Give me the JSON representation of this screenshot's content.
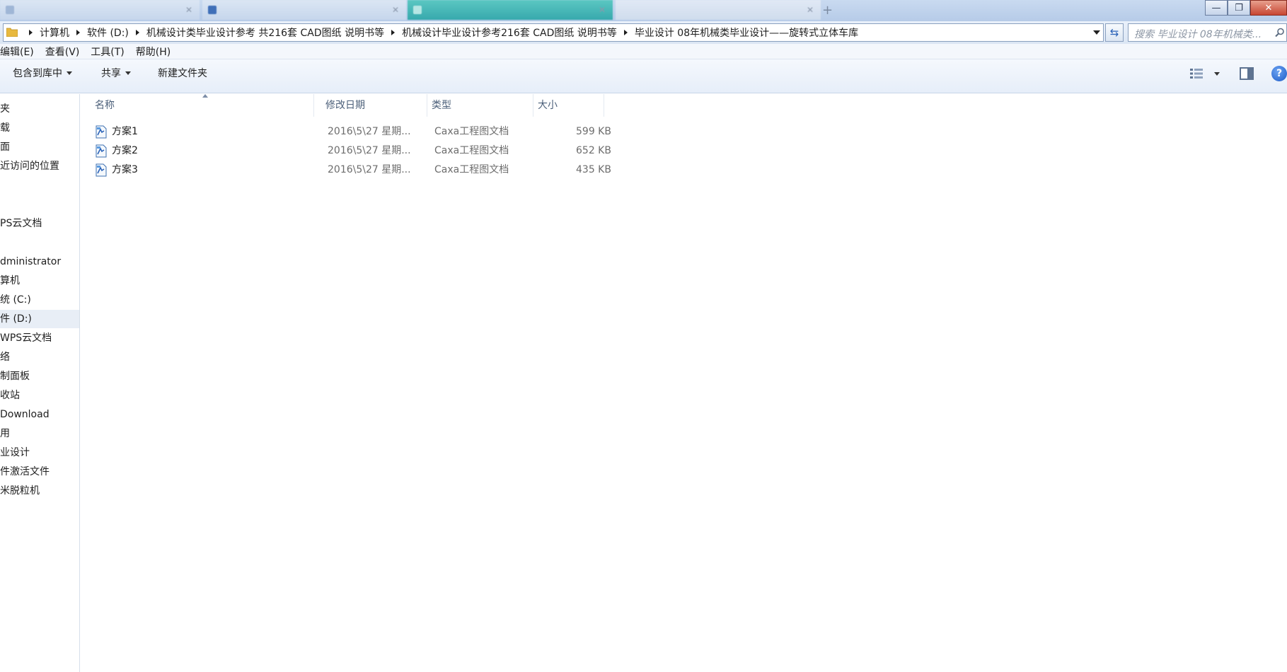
{
  "tabs": [
    {
      "label": "blurred tab"
    },
    {
      "label": "blurred tab"
    },
    {
      "label": "blurred tab"
    },
    {
      "label": "blurred tab"
    }
  ],
  "window_controls": {
    "minimize": "—",
    "maximize": "❐",
    "close": "✕"
  },
  "address": {
    "crumbs": [
      "计算机",
      "软件 (D:)",
      "机械设计类毕业设计参考 共216套 CAD图纸 说明书等",
      "机械设计毕业设计参考216套 CAD图纸 说明书等",
      "毕业设计 08年机械类毕业设计——旋转式立体车库"
    ]
  },
  "search": {
    "placeholder": "搜索 毕业设计 08年机械类..."
  },
  "menu": [
    "编辑(E)",
    "查看(V)",
    "工具(T)",
    "帮助(H)"
  ],
  "toolbar": {
    "include_library": "包含到库中",
    "share": "共享",
    "new_folder": "新建文件夹",
    "help": "?"
  },
  "sidebar": {
    "items": [
      {
        "label": "夹"
      },
      {
        "label": "载"
      },
      {
        "label": "面"
      },
      {
        "label": "近访问的位置"
      },
      {
        "label": "PS云文档"
      },
      {
        "label": "dministrator"
      },
      {
        "label": "算机"
      },
      {
        "label": "统 (C:)"
      },
      {
        "label": "件 (D:)"
      },
      {
        "label": "WPS云文档"
      },
      {
        "label": "络"
      },
      {
        "label": "制面板"
      },
      {
        "label": "收站"
      },
      {
        "label": "Download"
      },
      {
        "label": "用"
      },
      {
        "label": "业设计"
      },
      {
        "label": "件激活文件"
      },
      {
        "label": "米脱粒机"
      }
    ]
  },
  "columns": {
    "name": "名称",
    "date": "修改日期",
    "type": "类型",
    "size": "大小"
  },
  "files": [
    {
      "name": "方案1",
      "date": "2016\\5\\27 星期...",
      "type": "Caxa工程图文档",
      "size": "599 KB"
    },
    {
      "name": "方案2",
      "date": "2016\\5\\27 星期...",
      "type": "Caxa工程图文档",
      "size": "652 KB"
    },
    {
      "name": "方案3",
      "date": "2016\\5\\27 星期...",
      "type": "Caxa工程图文档",
      "size": "435 KB"
    }
  ],
  "colors": {
    "accent": "#2a62b8",
    "titlebar": "#b6cbe8",
    "selected": "#e8eef6"
  }
}
